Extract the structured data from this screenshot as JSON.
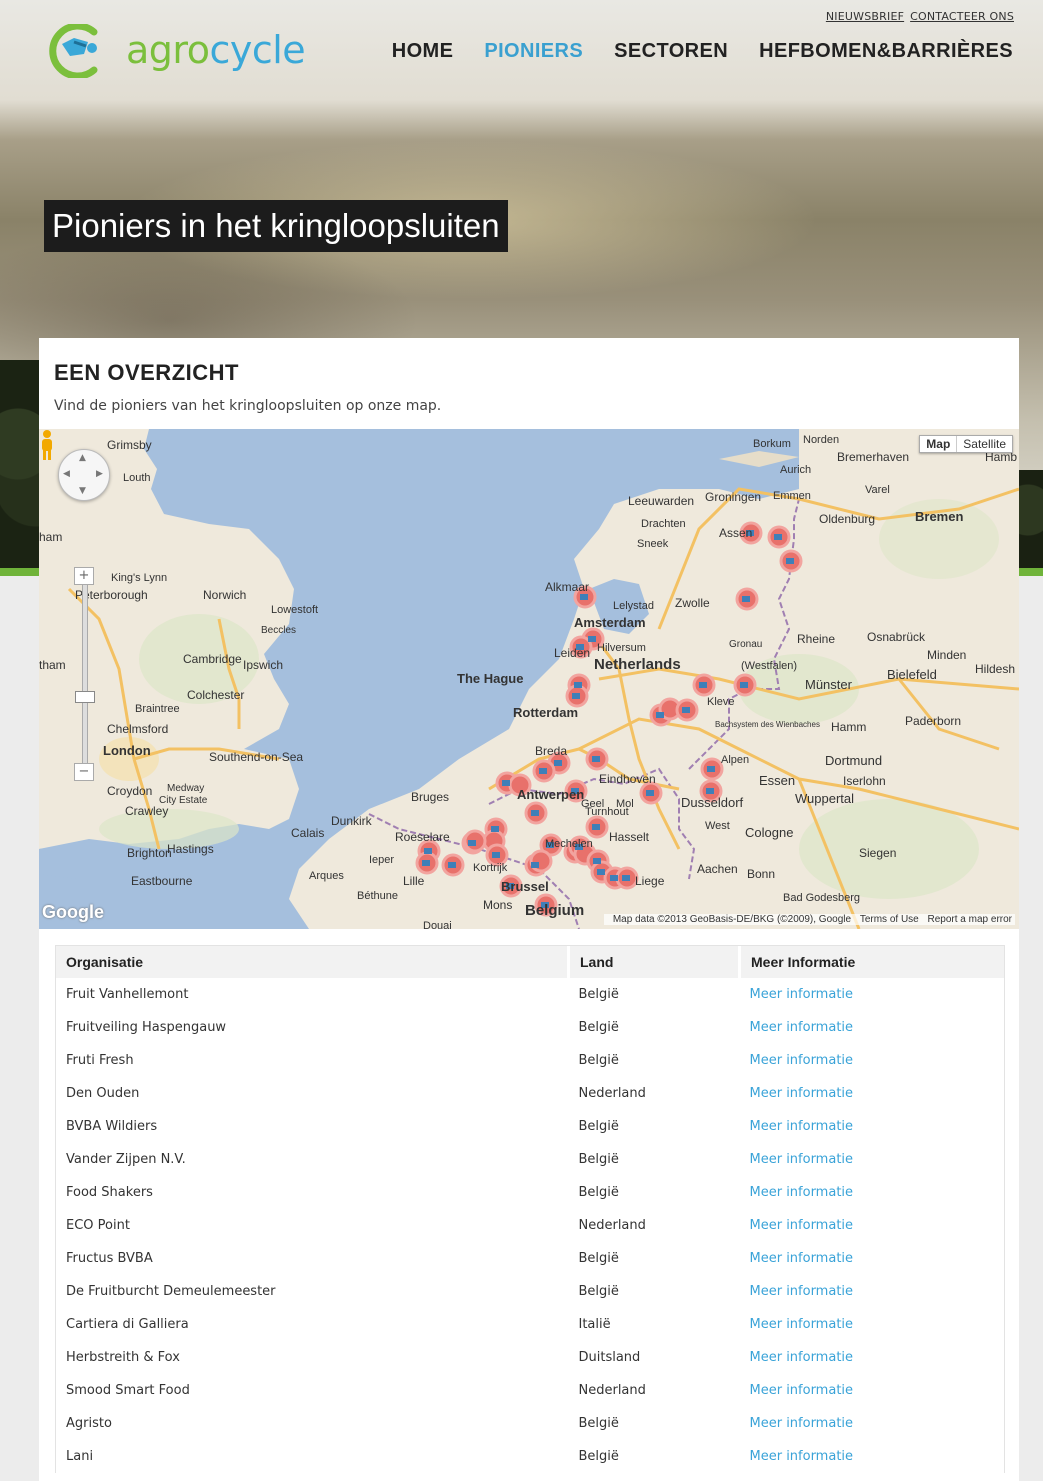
{
  "header": {
    "top_links": [
      "NIEUWSBRIEF",
      "CONTACTEER ONS"
    ],
    "logo": {
      "part1": "agro",
      "part2": "cycle"
    },
    "nav": [
      {
        "label": "HOME",
        "active": false
      },
      {
        "label": "PIONIERS",
        "active": true
      },
      {
        "label": "SECTOREN",
        "active": false
      },
      {
        "label": "HEFBOMEN&BARRIÈRES",
        "active": false
      }
    ]
  },
  "hero": {
    "title": "Pioniers in het kringloopsluiten"
  },
  "overview": {
    "title": "EEN OVERZICHT",
    "subtitle": "Vind de pioniers van het kringloopsluiten op onze map."
  },
  "map": {
    "type_buttons": [
      "Map",
      "Satellite"
    ],
    "google_label": "Google",
    "attribution": "Map data ©2013 GeoBasis-DE/BKG (©2009), Google",
    "terms": "Terms of Use",
    "report": "Report a map error",
    "labels": {
      "england": [
        "Grimsby",
        "Louth",
        "King's Lynn",
        "Peterborough",
        "Norwich",
        "Lowestoft",
        "Beccles",
        "Cambridge",
        "Ipswich",
        "Colchester",
        "Braintree",
        "Chelmsford",
        "London",
        "Southend-on-Sea",
        "Croydon",
        "Crawley",
        "Medway",
        "City Estate",
        "Brighton",
        "Hastings",
        "Eastbourne",
        "ham",
        "tham"
      ],
      "netherlands": [
        "Netherlands",
        "Amsterdam",
        "The Hague",
        "Rotterdam",
        "Leiden",
        "Alkmaar",
        "Lelystad",
        "Zwolle",
        "Leeuwarden",
        "Groningen",
        "Drachten",
        "Sneek",
        "Assen",
        "Breda",
        "Eindhoven",
        "Antwerpen",
        "Hilversum",
        "Emmen"
      ],
      "belgium": [
        "Belgium",
        "Brussel",
        "Bruges",
        "Dunkirk",
        "Calais",
        "Roeselare",
        "Ieper",
        "Kortrijk",
        "Lille",
        "Arques",
        "Béthune",
        "Mons",
        "Douai",
        "Mechelen",
        "Turnhout",
        "Geel",
        "Mol",
        "Hasselt",
        "Liege"
      ],
      "germany": [
        "Borkum",
        "Norden",
        "Aurich",
        "Bremerhaven",
        "Varel",
        "Oldenburg",
        "Bremen",
        "Hamb",
        "Rheine",
        "Osnabrück",
        "Münster",
        "Bielefeld",
        "Minden",
        "Hildesh",
        "Hamm",
        "Paderborn",
        "Dortmund",
        "Essen",
        "Iserlohn",
        "Wuppertal",
        "Dusseldorf",
        "Cologne",
        "Aachen",
        "Bonn",
        "Siegen",
        "Bad Godesberg",
        "Gronau",
        "(Westfalen)",
        "Bachsystem des Wienbaches",
        "West",
        "Alpen",
        "Kleve"
      ]
    },
    "marker_count": 52
  },
  "table": {
    "headers": [
      "Organisatie",
      "Land",
      "Meer Informatie"
    ],
    "rows": [
      [
        "Fruit Vanhellemont",
        "België",
        "Meer informatie"
      ],
      [
        "Fruitveiling Haspengauw",
        "België",
        "Meer informatie"
      ],
      [
        "Fruti Fresh",
        "België",
        "Meer informatie"
      ],
      [
        "Den Ouden",
        "Nederland",
        "Meer informatie"
      ],
      [
        "BVBA Wildiers",
        "België",
        "Meer informatie"
      ],
      [
        "Vander Zijpen N.V.",
        "België",
        "Meer informatie"
      ],
      [
        "Food Shakers",
        "België",
        "Meer informatie"
      ],
      [
        "ECO Point",
        "Nederland",
        "Meer informatie"
      ],
      [
        "Fructus BVBA",
        "België",
        "Meer informatie"
      ],
      [
        "De Fruitburcht Demeulemeester",
        "België",
        "Meer informatie"
      ],
      [
        "Cartiera di Galliera",
        "Italië",
        "Meer informatie"
      ],
      [
        "Herbstreith & Fox",
        "Duitsland",
        "Meer informatie"
      ],
      [
        "Smood Smart Food",
        "Nederland",
        "Meer informatie"
      ],
      [
        "Agristo",
        "België",
        "Meer informatie"
      ],
      [
        "Lani",
        "België",
        "Meer informatie"
      ]
    ]
  },
  "colors": {
    "accent_blue": "#3aa0d0",
    "brand_green": "#7bbf3c",
    "marker_ring": "#e8716b"
  }
}
